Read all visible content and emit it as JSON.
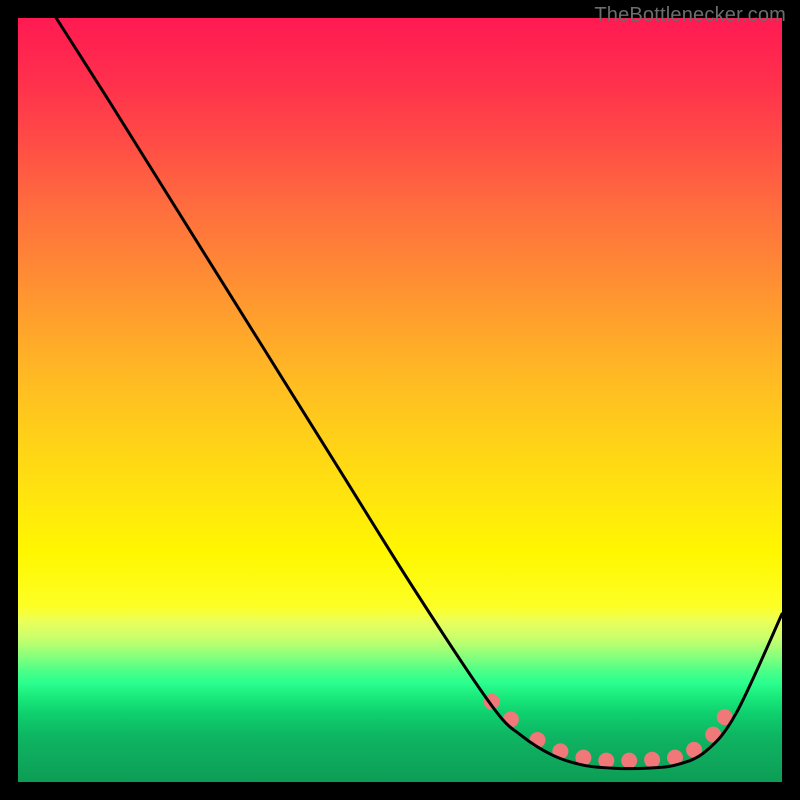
{
  "watermark": "TheBottlenecker.com",
  "chart_data": {
    "type": "line",
    "title": "",
    "xlabel": "",
    "ylabel": "",
    "xlim": [
      0,
      100
    ],
    "ylim": [
      0,
      100
    ],
    "series": [
      {
        "name": "bottleneck-curve",
        "color": "#000000",
        "x": [
          5,
          12,
          22,
          32,
          42,
          52,
          62,
          66,
          70,
          74,
          78,
          82,
          86,
          90,
          94,
          100
        ],
        "y": [
          100,
          89,
          73,
          57,
          41,
          25,
          10,
          6,
          3.5,
          2.2,
          1.8,
          1.8,
          2.2,
          4,
          9,
          22
        ]
      }
    ],
    "markers": {
      "name": "optimal-range-dots",
      "color": "#f07878",
      "radius": 8,
      "x": [
        62,
        64.5,
        68,
        71,
        74,
        77,
        80,
        83,
        86,
        88.5,
        91,
        92.5
      ],
      "y": [
        10.5,
        8.2,
        5.5,
        4,
        3.2,
        2.8,
        2.8,
        2.9,
        3.2,
        4.2,
        6.2,
        8.5
      ]
    }
  }
}
